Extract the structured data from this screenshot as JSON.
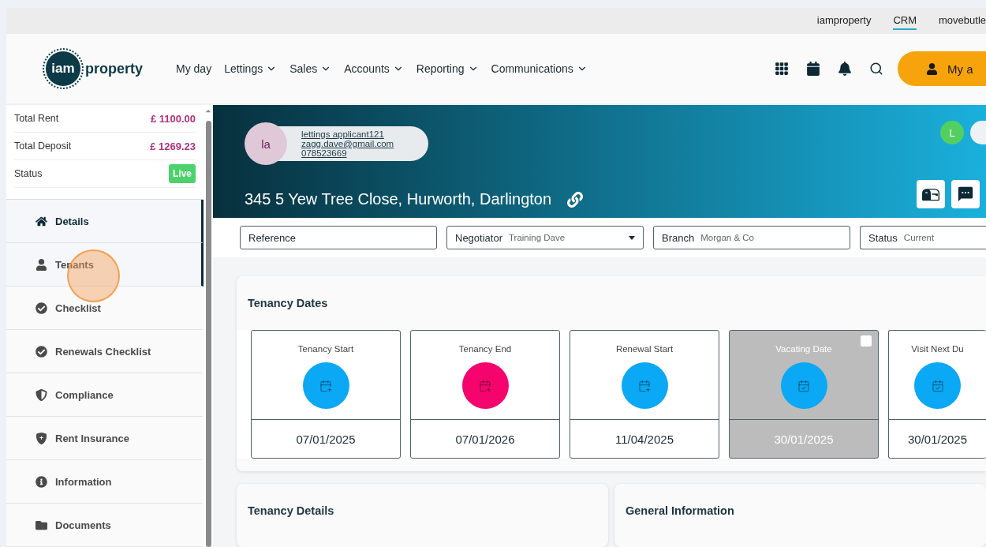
{
  "top_links": [
    {
      "label": "iamproperty",
      "selected": false
    },
    {
      "label": "CRM",
      "selected": true
    },
    {
      "label": "movebutle",
      "selected": false
    }
  ],
  "logo": {
    "mark": "iam",
    "word": "property"
  },
  "nav": [
    {
      "label": "My day",
      "has_menu": false
    },
    {
      "label": "Lettings",
      "has_menu": true
    },
    {
      "label": "Sales",
      "has_menu": true
    },
    {
      "label": "Accounts",
      "has_menu": true
    },
    {
      "label": "Reporting",
      "has_menu": true
    },
    {
      "label": "Communications",
      "has_menu": true
    }
  ],
  "account_button": {
    "label": "My a"
  },
  "summary": [
    {
      "label": "Total Rent",
      "value": "£ 1100.00",
      "kind": "amount"
    },
    {
      "label": "Total Deposit",
      "value": "£ 1269.23",
      "kind": "amount"
    },
    {
      "label": "Status",
      "value": "Live",
      "kind": "badge"
    }
  ],
  "sidebar": {
    "items": [
      {
        "label": "Details",
        "selected": true,
        "highlighted": true
      },
      {
        "label": "Tenants",
        "selected": false,
        "highlighted": true
      },
      {
        "label": "Checklist",
        "selected": false,
        "highlighted": false
      },
      {
        "label": "Renewals Checklist",
        "selected": false,
        "highlighted": false
      },
      {
        "label": "Compliance",
        "selected": false,
        "highlighted": false
      },
      {
        "label": "Rent Insurance",
        "selected": false,
        "highlighted": false
      },
      {
        "label": "Information",
        "selected": false,
        "highlighted": false
      },
      {
        "label": "Documents",
        "selected": false,
        "highlighted": false
      }
    ]
  },
  "contact": {
    "initials": "la",
    "name": "lettings applicant121",
    "email": "zagg.dave@gmail.com",
    "phone": "078523669"
  },
  "property": {
    "address": "345 5 Yew Tree Close, Hurworth, Darlington",
    "badge": "L"
  },
  "fields": [
    {
      "label": "Reference",
      "dropdown": false
    },
    {
      "label": "Negotiator",
      "value": "Training Dave",
      "dropdown": true
    },
    {
      "label": "Branch",
      "value": "Morgan & Co",
      "dropdown": false
    },
    {
      "label": "Status",
      "value": "Current",
      "dropdown": false
    }
  ],
  "tenancy_dates": {
    "title": "Tenancy Dates",
    "cards": [
      {
        "label": "Tenancy Start",
        "date": "07/01/2025",
        "color": "#0aa8f5",
        "disabled": false
      },
      {
        "label": "Tenancy End",
        "date": "07/01/2026",
        "color": "#f5046e",
        "disabled": false
      },
      {
        "label": "Renewal Start",
        "date": "11/04/2025",
        "color": "#0aa8f5",
        "disabled": false
      },
      {
        "label": "Vacating Date",
        "date": "30/01/2025",
        "color": "#0aa8f5",
        "disabled": true,
        "checkbox": {
          "checked": false
        }
      },
      {
        "label": "Visit Next Du",
        "date": "30/01/2025",
        "color": "#0aa8f5",
        "disabled": false
      }
    ]
  },
  "panels": [
    {
      "title": "Tenancy Details"
    },
    {
      "title": "General Information"
    }
  ]
}
